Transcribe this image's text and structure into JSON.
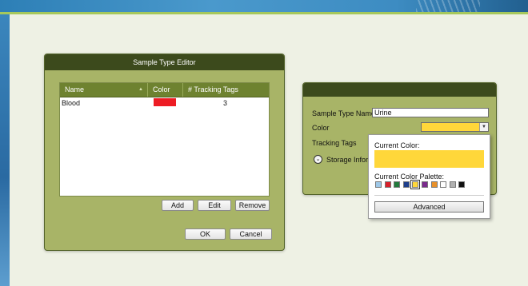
{
  "editor": {
    "title": "Sample Type Editor",
    "columns": [
      "Name",
      "Color",
      "# Tracking Tags"
    ],
    "rows": [
      {
        "name": "Blood",
        "color": "#ed1c24",
        "tracking_tags": "3"
      }
    ],
    "buttons": {
      "add": "Add",
      "edit": "Edit",
      "remove": "Remove",
      "ok": "OK",
      "cancel": "Cancel"
    }
  },
  "properties": {
    "sample_type_name_label": "Sample Type Name",
    "sample_type_name_value": "Urine",
    "color_label": "Color",
    "color_value": "#ffd73a",
    "tracking_tags_label": "Tracking Tags",
    "storage_label": "Storage Inform"
  },
  "color_popup": {
    "current_color_label": "Current Color:",
    "current_color": "#ffd73a",
    "palette_label": "Current Color Palette:",
    "palette": [
      "#9ec8e8",
      "#d8202a",
      "#227a3c",
      "#1e3f8c",
      "#ffd73a",
      "#7a2a8c",
      "#e8902a",
      "#ffffff",
      "#b0b0b0",
      "#111111"
    ],
    "selected_index": 4,
    "advanced_label": "Advanced"
  }
}
